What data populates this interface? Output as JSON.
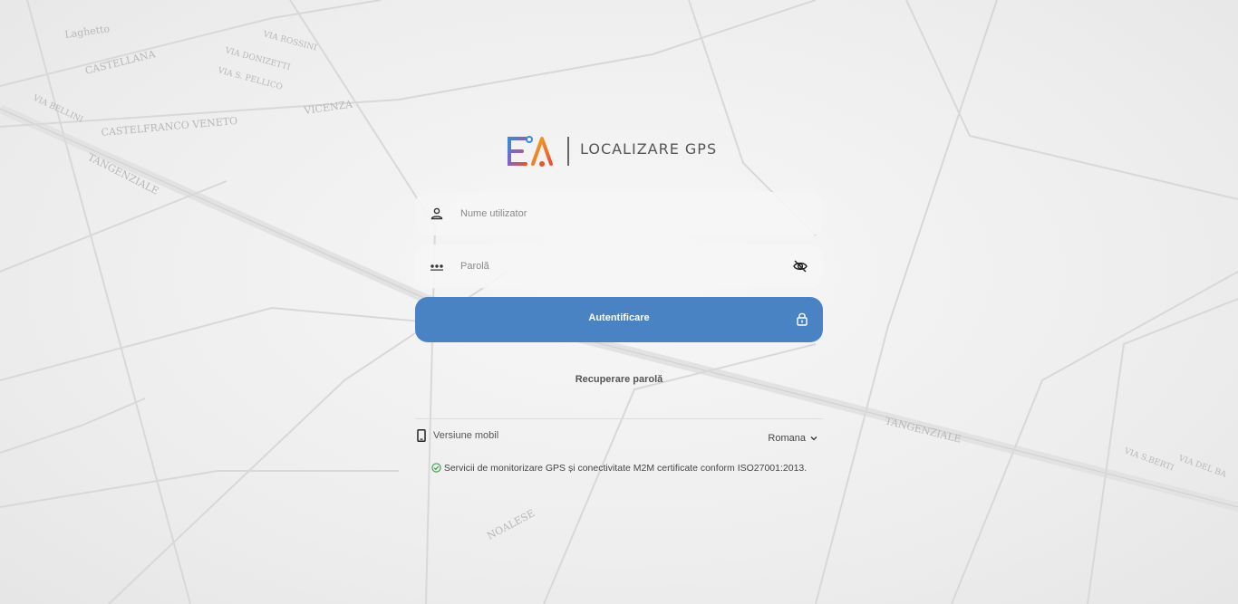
{
  "brand": {
    "logo_text": "LOCALIZARE GPS"
  },
  "login": {
    "username_placeholder": "Nume utilizator",
    "password_placeholder": "Parolă",
    "submit_label": "Autentificare",
    "recover_label": "Recuperare parolă"
  },
  "footer": {
    "mobile_label": "Versiune mobil",
    "language": "Romana",
    "certification": "Servicii de monitorizare GPS și conectivitate M2M certificate conform ISO27001:2013."
  },
  "colors": {
    "accent": "#4a83c4",
    "logo_gradient": [
      "#3a8bd6",
      "#f5a623",
      "#e8542f"
    ],
    "check": "#2ea44f"
  },
  "icons": {
    "username": "user-icon",
    "password": "password-dots-icon",
    "toggle_password": "eye-off-icon",
    "submit": "lock-icon",
    "mobile": "mobile-phone-icon",
    "language": "chevron-down-icon",
    "certification": "check-circle-icon"
  },
  "background": {
    "map_labels": [
      "Laghetto",
      "CASTELLANA",
      "VIA BELLINI",
      "CASTELFRANCO VENETO",
      "VICENZA",
      "TANGENZIALE",
      "VIA DONIZETTI",
      "VIA ROSSINI",
      "VIA S. PELLICO",
      "NOALESE",
      "VIA DEL BA",
      "VIA S.BERTI"
    ]
  }
}
